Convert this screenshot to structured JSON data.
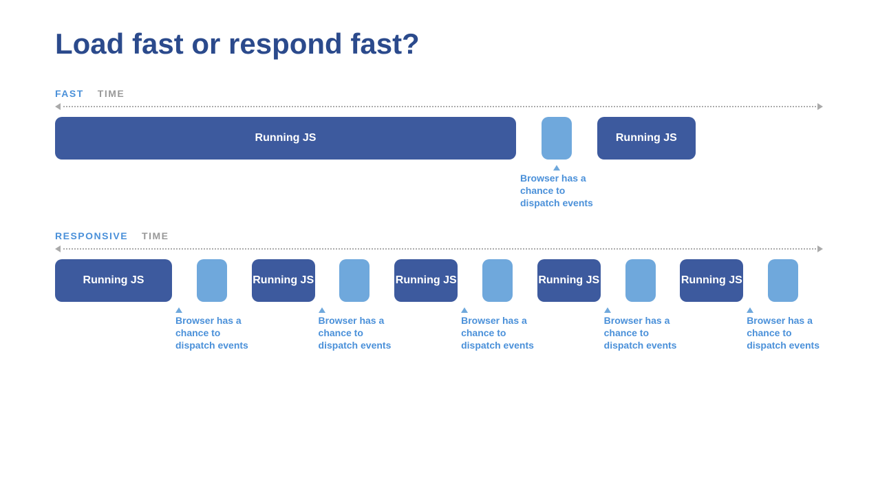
{
  "title": "Load fast or respond fast?",
  "fast": {
    "label": "FAST",
    "time_label": "TIME",
    "blocks": [
      {
        "text": "Running JS",
        "type": "large"
      },
      {
        "text": "",
        "type": "gap"
      },
      {
        "text": "Running JS",
        "type": "medium"
      }
    ],
    "annotation": {
      "arrow": "↑",
      "lines": [
        "Browser has a",
        "chance to",
        "dispatch events"
      ]
    }
  },
  "responsive": {
    "label": "RESPONSIVE",
    "time_label": "TIME",
    "blocks": [
      {
        "text": "Running JS"
      },
      {
        "text": "Running JS"
      },
      {
        "text": "Running JS"
      },
      {
        "text": "Running JS"
      },
      {
        "text": "Running JS"
      }
    ],
    "annotations": [
      {
        "lines": [
          "Browser has a",
          "chance to",
          "dispatch events"
        ]
      },
      {
        "lines": [
          "Browser has a",
          "chance to",
          "dispatch events"
        ]
      },
      {
        "lines": [
          "Browser has a",
          "chance to",
          "dispatch events"
        ]
      },
      {
        "lines": [
          "Browser has a",
          "chance to",
          "dispatch events"
        ]
      },
      {
        "lines": [
          "Browser has a",
          "chance to",
          "dispatch events"
        ]
      }
    ]
  }
}
